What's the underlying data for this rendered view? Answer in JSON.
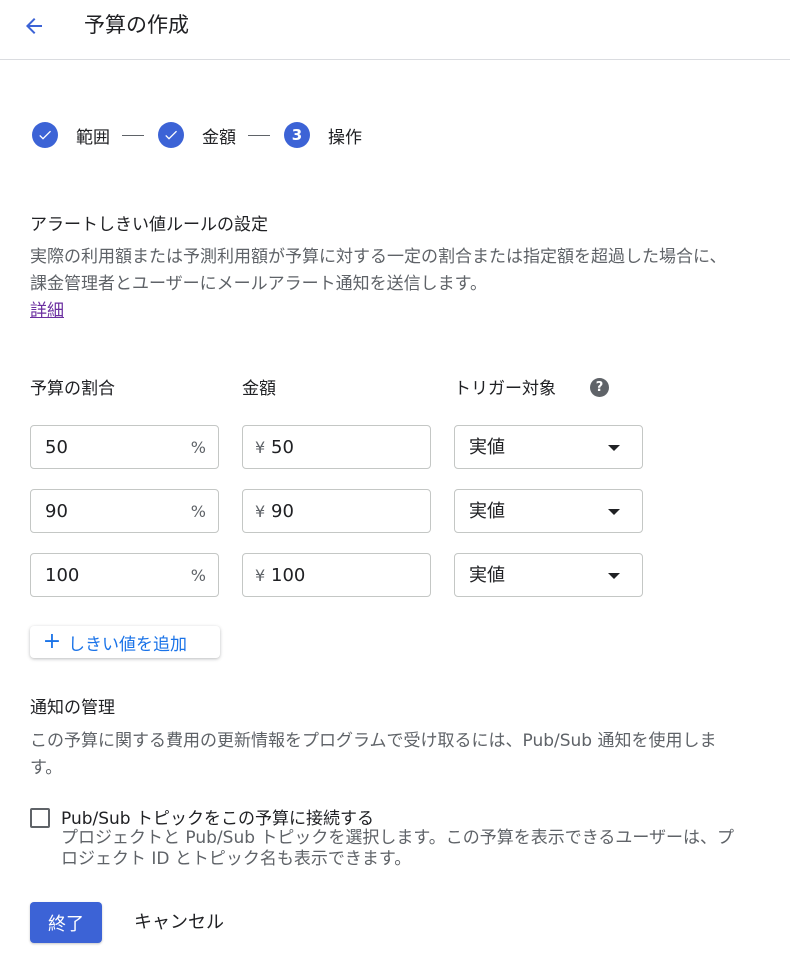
{
  "header": {
    "title": "予算の作成",
    "back_icon": "arrow-left-icon"
  },
  "colors": {
    "accent": "#3c63d6",
    "link": "#1a73e8",
    "visited_link": "#6b2fa0",
    "muted": "#5f6368"
  },
  "stepper": {
    "steps": [
      {
        "label": "範囲",
        "state": "completed",
        "icon": "check-icon"
      },
      {
        "label": "金額",
        "state": "completed",
        "icon": "check-icon"
      },
      {
        "label": "操作",
        "state": "current",
        "number": "3"
      }
    ]
  },
  "alert_rules": {
    "title": "アラートしきい値ルールの設定",
    "description": "実際の利用額または予測利用額が予算に対する一定の割合または指定額を超過した場合に、課金管理者とユーザーにメールアラート通知を送信します。",
    "learn_more": "詳細",
    "columns": {
      "percent": "予算の割合",
      "amount": "金額",
      "trigger": "トリガー対象"
    },
    "rows": [
      {
        "percent": "50",
        "percent_suffix": "%",
        "currency": "¥",
        "amount": "50",
        "trigger": "実値"
      },
      {
        "percent": "90",
        "percent_suffix": "%",
        "currency": "¥",
        "amount": "90",
        "trigger": "実値"
      },
      {
        "percent": "100",
        "percent_suffix": "%",
        "currency": "¥",
        "amount": "100",
        "trigger": "実値"
      }
    ],
    "add_button": "しきい値を追加"
  },
  "notifications": {
    "title": "通知の管理",
    "description": "この予算に関する費用の更新情報をプログラムで受け取るには、Pub/Sub 通知を使用します。",
    "pubsub_checkbox": {
      "label": "Pub/Sub トピックをこの予算に接続する",
      "description": "プロジェクトと Pub/Sub トピックを選択します。この予算を表示できるユーザーは、プロジェクト ID とトピック名も表示できます。",
      "checked": false
    }
  },
  "actions": {
    "finish": "終了",
    "cancel": "キャンセル"
  }
}
